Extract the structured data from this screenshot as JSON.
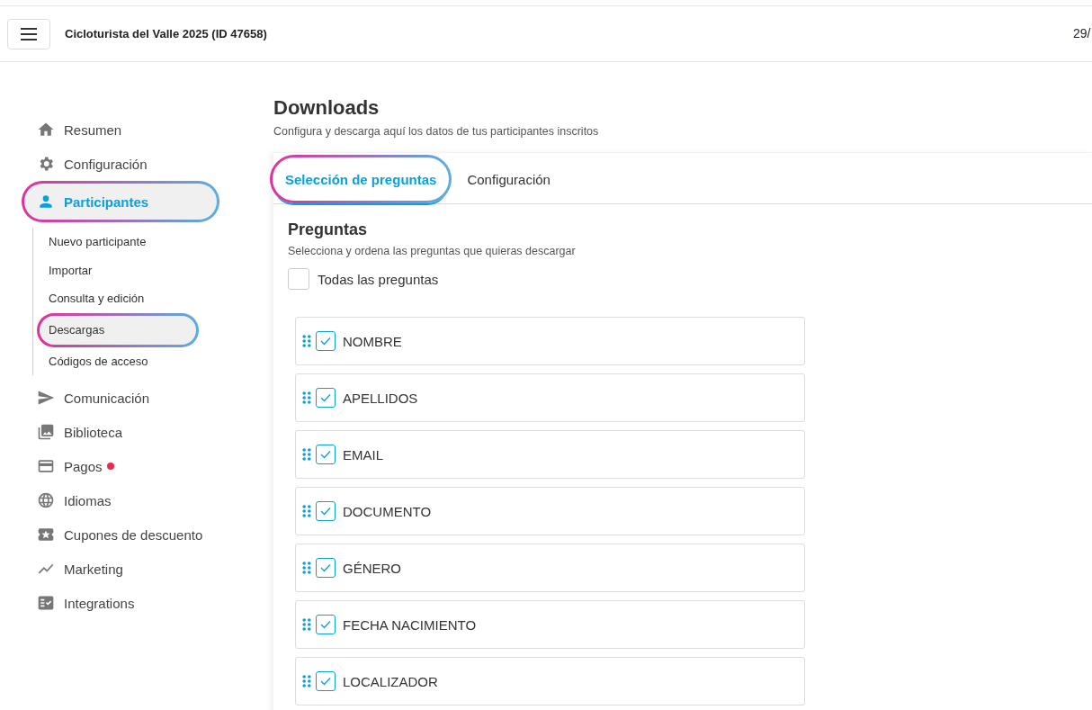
{
  "header": {
    "title": "Cicloturista del Valle 2025 (ID 47658)",
    "date": "29/"
  },
  "sidebar": {
    "items": [
      {
        "label": "Resumen",
        "selected": false,
        "highlighted": false,
        "alert": false
      },
      {
        "label": "Configuración",
        "selected": false,
        "highlighted": false,
        "alert": false
      },
      {
        "label": "Participantes",
        "selected": true,
        "highlighted": true,
        "alert": false,
        "children": [
          {
            "label": "Nuevo participante",
            "selected": false,
            "highlighted": false
          },
          {
            "label": "Importar",
            "selected": false,
            "highlighted": false
          },
          {
            "label": "Consulta y edición",
            "selected": false,
            "highlighted": false
          },
          {
            "label": "Descargas",
            "selected": true,
            "highlighted": true
          },
          {
            "label": "Códigos de acceso",
            "selected": false,
            "highlighted": false
          }
        ]
      },
      {
        "label": "Comunicación",
        "selected": false,
        "highlighted": false,
        "alert": false
      },
      {
        "label": "Biblioteca",
        "selected": false,
        "highlighted": false,
        "alert": false
      },
      {
        "label": "Pagos",
        "selected": false,
        "highlighted": false,
        "alert": true
      },
      {
        "label": "Idiomas",
        "selected": false,
        "highlighted": false,
        "alert": false
      },
      {
        "label": "Cupones de descuento",
        "selected": false,
        "highlighted": false,
        "alert": false
      },
      {
        "label": "Marketing",
        "selected": false,
        "highlighted": false,
        "alert": false
      },
      {
        "label": "Integrations",
        "selected": false,
        "highlighted": false,
        "alert": false
      }
    ]
  },
  "page": {
    "title": "Downloads",
    "subtitle": "Configura y descarga aquí los datos de tus participantes inscritos"
  },
  "tabs": [
    {
      "label": "Selección de preguntas",
      "selected": true,
      "highlighted": true
    },
    {
      "label": "Configuración",
      "selected": false,
      "highlighted": false
    }
  ],
  "questions": {
    "title": "Preguntas",
    "subtitle": "Selecciona y ordena las preguntas que quieras descargar",
    "select_all": {
      "label": "Todas las preguntas",
      "checked": false
    },
    "items": [
      {
        "label": "NOMBRE",
        "checked": true
      },
      {
        "label": "APELLIDOS",
        "checked": true
      },
      {
        "label": "EMAIL",
        "checked": true
      },
      {
        "label": "DOCUMENTO",
        "checked": true
      },
      {
        "label": "GÉNERO",
        "checked": true
      },
      {
        "label": "FECHA NACIMIENTO",
        "checked": true
      },
      {
        "label": "LOCALIZADOR",
        "checked": true
      }
    ]
  }
}
